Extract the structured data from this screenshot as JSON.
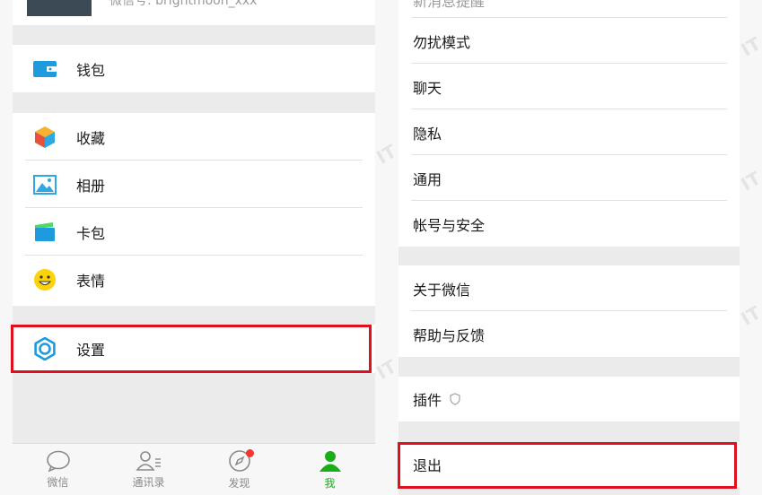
{
  "left": {
    "profile_subtitle": "微信号: brightmoon_xxx",
    "wallet": "钱包",
    "favorites": "收藏",
    "album": "相册",
    "cards": "卡包",
    "stickers": "表情",
    "settings": "设置",
    "tabs": [
      {
        "label": "微信",
        "icon": "chat-icon"
      },
      {
        "label": "通讯录",
        "icon": "contacts-icon"
      },
      {
        "label": "发现",
        "icon": "compass-icon"
      },
      {
        "label": "我",
        "icon": "me-icon"
      }
    ]
  },
  "right": {
    "partial_top": "新消息提醒",
    "dnd": "勿扰模式",
    "chat": "聊天",
    "privacy": "隐私",
    "general": "通用",
    "account": "帐号与安全",
    "about": "关于微信",
    "help": "帮助与反馈",
    "plugins": "插件",
    "logout": "退出"
  },
  "colors": {
    "highlight": "#e0101e",
    "active_tab": "#1aad19",
    "badge": "#f43530"
  }
}
